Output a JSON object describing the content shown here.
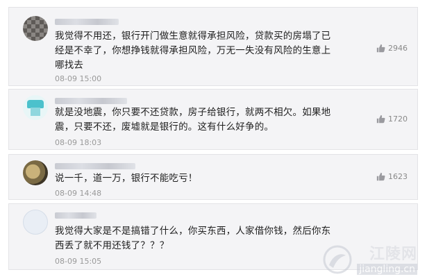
{
  "comments": [
    {
      "text_lines": [
        "我觉得不用还，银行开门做生意就得承担风险，贷款买的房塌了已",
        "经是不幸了，你想挣钱就得承担风险，万无一失没有风险的生意上",
        "哪找去"
      ],
      "time": "08-09 15:00",
      "likes": "2946"
    },
    {
      "text_lines": [
        "就是没地震，你只要不还贷款，房子给银行，就两不相欠。如果地",
        "震，只要不还，废墟就是银行的。这有什么好争的。"
      ],
      "time": "08-09 18:03",
      "likes": "1720"
    },
    {
      "text_lines": [
        "说一千，道一万，银行不能吃亏！"
      ],
      "time": "08-09 14:48",
      "likes": "1623"
    },
    {
      "text_lines": [
        "我觉得大家是不是搞错了什么，你买东西，人家借你钱，然后你东",
        "西丢了就不用还钱了？？？"
      ],
      "time": "08-09 15:05",
      "likes": ""
    }
  ],
  "watermark": {
    "title": "江陵网",
    "url": "jiangling.cn"
  },
  "icons": {
    "like": "thumbs-up-icon"
  },
  "colors": {
    "card_bg": "#f4f4f6",
    "time_text": "#999999"
  }
}
